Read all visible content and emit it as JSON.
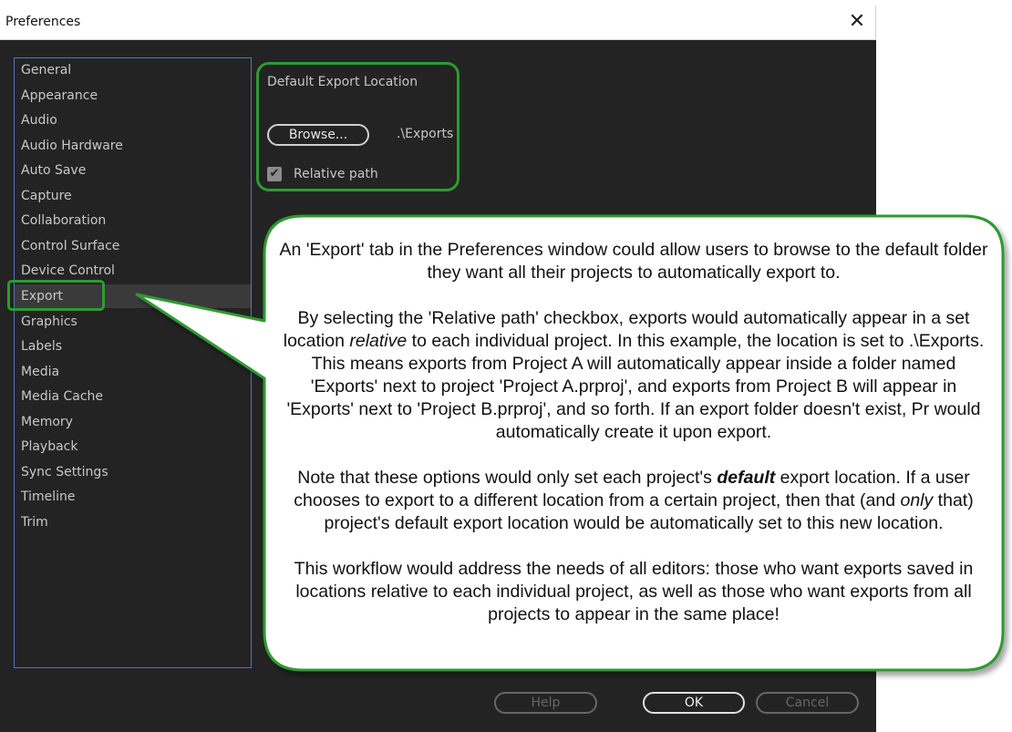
{
  "window": {
    "title": "Preferences",
    "close_glyph": "✕"
  },
  "sidebar": {
    "items": [
      {
        "label": "General"
      },
      {
        "label": "Appearance"
      },
      {
        "label": "Audio"
      },
      {
        "label": "Audio Hardware"
      },
      {
        "label": "Auto Save"
      },
      {
        "label": "Capture"
      },
      {
        "label": "Collaboration"
      },
      {
        "label": "Control Surface"
      },
      {
        "label": "Device Control"
      },
      {
        "label": "Export"
      },
      {
        "label": "Graphics"
      },
      {
        "label": "Labels"
      },
      {
        "label": "Media"
      },
      {
        "label": "Media Cache"
      },
      {
        "label": "Memory"
      },
      {
        "label": "Playback"
      },
      {
        "label": "Sync Settings"
      },
      {
        "label": "Timeline"
      },
      {
        "label": "Trim"
      }
    ],
    "selected": "Export"
  },
  "export_panel": {
    "section_title": "Default Export Location",
    "browse_label": "Browse...",
    "path_value": ".\\Exports",
    "relative_path_label": "Relative path",
    "relative_path_checked": true
  },
  "footer": {
    "help_label": "Help",
    "ok_label": "OK",
    "cancel_label": "Cancel"
  },
  "callout": {
    "p1": "An 'Export' tab in the Preferences window could allow users to browse to the default folder they want all their projects to automatically export to.",
    "p2_a": "By selecting the 'Relative path' checkbox, exports would automatically appear in a set location ",
    "p2_em": "relative",
    "p2_b": " to each individual project.  In this example, the location is set to .\\Exports.  This means exports from Project A will automatically appear inside a folder named 'Exports' next to project 'Project A.prproj', and exports from Project B will appear in 'Exports' next to 'Project B.prproj', and so forth.  If an export folder doesn't exist, Pr would automatically create it upon export.",
    "p3_a": "Note that these options would only set each project's ",
    "p3_strong": "default",
    "p3_b": " export location.  If a user chooses to export to a different location from a certain project, then that (and ",
    "p3_em": "only",
    "p3_c": " that) project's default export location would be automatically set to this new location.",
    "p4": "This workflow would address the needs of all editors: those who want exports saved in locations relative to each individual project, as well as those who want exports from all projects to appear in the same place!"
  },
  "colors": {
    "panel_bg": "#232323",
    "highlight_green": "#2e9a32",
    "sidebar_border": "#4d78c4"
  }
}
